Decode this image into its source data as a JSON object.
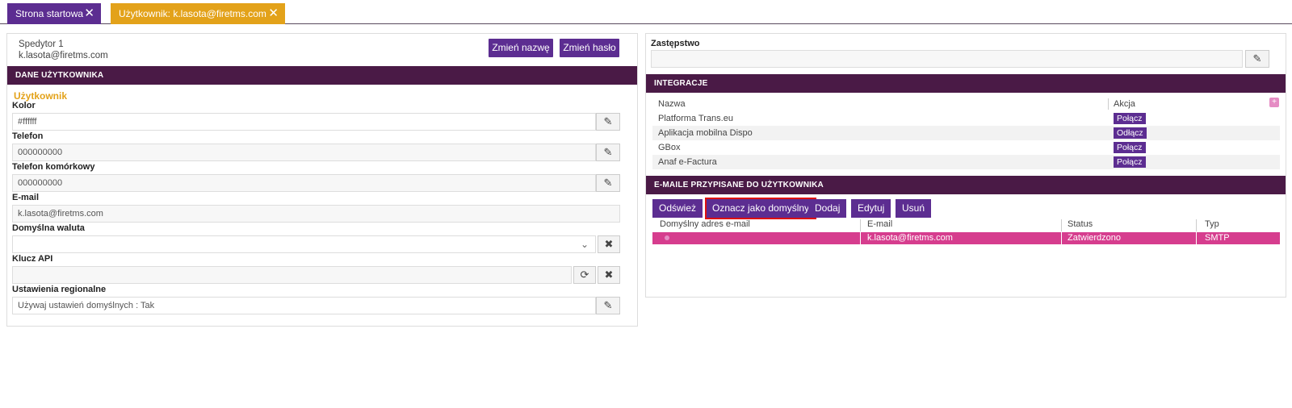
{
  "tabs": [
    {
      "label": "Strona startowa"
    },
    {
      "label": "Użytkownik: k.lasota@firetms.com"
    }
  ],
  "user": {
    "name": "Spedytor 1",
    "email": "k.lasota@firetms.com",
    "rename_label": "Zmień nazwę",
    "password_label": "Zmień hasło"
  },
  "dane": {
    "section_title": "DANE UŻYTKOWNIKA",
    "subheading": "Użytkownik",
    "kolor_label": "Kolor",
    "kolor_value": "#ffffff",
    "telefon_label": "Telefon",
    "telefon_value": "000000000",
    "komorkowy_label": "Telefon komórkowy",
    "komorkowy_value": "000000000",
    "email_label": "E-mail",
    "email_value": "k.lasota@firetms.com",
    "waluta_label": "Domyślna waluta",
    "waluta_value": "",
    "api_label": "Klucz API",
    "api_value": "",
    "regional_label": "Ustawienia regionalne",
    "regional_value": "Używaj ustawień domyślnych : Tak"
  },
  "zastepstwo": {
    "label": "Zastępstwo",
    "value": ""
  },
  "integracje": {
    "section_title": "INTEGRACJE",
    "col_name": "Nazwa",
    "col_action": "Akcja",
    "rows": [
      {
        "name": "Platforma Trans.eu",
        "action": "Połącz"
      },
      {
        "name": "Aplikacja mobilna Dispo",
        "action": "Odłącz"
      },
      {
        "name": "GBox",
        "action": "Połącz"
      },
      {
        "name": "Anaf e-Factura",
        "action": "Połącz"
      }
    ]
  },
  "emails": {
    "section_title": "E-MAILE PRZYPISANE DO UŻYTKOWNIKA",
    "buttons": {
      "refresh": "Odśwież",
      "default": "Oznacz jako domyślny",
      "add": "Dodaj",
      "edit": "Edytuj",
      "delete": "Usuń"
    },
    "columns": [
      "Domyślny adres e-mail",
      "E-mail",
      "Status",
      "Typ"
    ],
    "rows": [
      {
        "default": "",
        "email": "k.lasota@firetms.com",
        "status": "Zatwierdzono",
        "type": "SMTP"
      }
    ]
  },
  "colors": {
    "primary": "#5c2d91",
    "section": "#4a1a46",
    "accent": "#e3a21a",
    "highlight_row": "#d63d8e"
  }
}
